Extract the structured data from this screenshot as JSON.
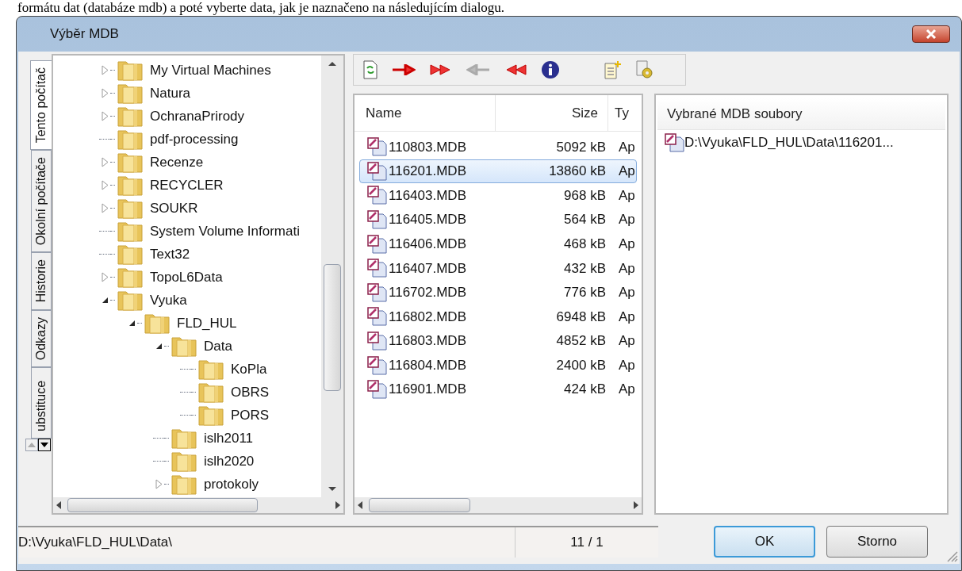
{
  "document_text": "formátu dat (databáze mdb) a poté vyberte data, jak je naznačeno na následujícím dialogu.",
  "window": {
    "title": "Výběr MDB"
  },
  "side_tabs": [
    {
      "label": "Tento počítač",
      "selected": true
    },
    {
      "label": "Okolní počítače",
      "selected": false
    },
    {
      "label": "Historie",
      "selected": false
    },
    {
      "label": "Odkazy",
      "selected": false
    },
    {
      "label": "ubstituce",
      "selected": false
    }
  ],
  "tree": [
    {
      "label": "My Virtual Machines",
      "expandable": true,
      "expanded": false
    },
    {
      "label": "Natura",
      "expandable": true,
      "expanded": false
    },
    {
      "label": "OchranaPrirody",
      "expandable": true,
      "expanded": false
    },
    {
      "label": "pdf-processing",
      "expandable": false
    },
    {
      "label": "Recenze",
      "expandable": true,
      "expanded": false
    },
    {
      "label": "RECYCLER",
      "expandable": true,
      "expanded": false
    },
    {
      "label": "SOUKR",
      "expandable": true,
      "expanded": false
    },
    {
      "label": "System Volume Informati",
      "expandable": false
    },
    {
      "label": "Text32",
      "expandable": false
    },
    {
      "label": "TopoL6Data",
      "expandable": true,
      "expanded": false
    },
    {
      "label": "Vyuka",
      "expandable": true,
      "expanded": true,
      "children": [
        {
          "label": "FLD_HUL",
          "expandable": true,
          "expanded": true,
          "children": [
            {
              "label": "Data",
              "expandable": true,
              "expanded": true,
              "children": [
                {
                  "label": "KoPla",
                  "expandable": false
                },
                {
                  "label": "OBRS",
                  "expandable": false
                },
                {
                  "label": "PORS",
                  "expandable": false
                }
              ]
            },
            {
              "label": "islh2011",
              "expandable": false
            },
            {
              "label": "islh2020",
              "expandable": false
            },
            {
              "label": "protokoly",
              "expandable": true,
              "expanded": false
            }
          ]
        }
      ]
    }
  ],
  "file_list": {
    "columns": [
      "Name",
      "Size",
      "Ty"
    ],
    "rows": [
      {
        "name": "110803.MDB",
        "size": "5092 kB",
        "type": "Ap",
        "selected": false
      },
      {
        "name": "116201.MDB",
        "size": "13860 kB",
        "type": "Ap",
        "selected": true
      },
      {
        "name": "116403.MDB",
        "size": "968 kB",
        "type": "Ap",
        "selected": false
      },
      {
        "name": "116405.MDB",
        "size": "564 kB",
        "type": "Ap",
        "selected": false
      },
      {
        "name": "116406.MDB",
        "size": "468 kB",
        "type": "Ap",
        "selected": false
      },
      {
        "name": "116407.MDB",
        "size": "432 kB",
        "type": "Ap",
        "selected": false
      },
      {
        "name": "116702.MDB",
        "size": "776 kB",
        "type": "Ap",
        "selected": false
      },
      {
        "name": "116802.MDB",
        "size": "6948 kB",
        "type": "Ap",
        "selected": false
      },
      {
        "name": "116803.MDB",
        "size": "4852 kB",
        "type": "Ap",
        "selected": false
      },
      {
        "name": "116804.MDB",
        "size": "2400 kB",
        "type": "Ap",
        "selected": false
      },
      {
        "name": "116901.MDB",
        "size": "424 kB",
        "type": "Ap",
        "selected": false
      }
    ]
  },
  "selected_list": {
    "header": "Vybrané MDB soubory",
    "items": [
      "D:\\Vyuka\\FLD_HUL\\Data\\116201..."
    ]
  },
  "status_bar": {
    "path": "D:\\Vyuka\\FLD_HUL\\Data\\",
    "count": "11 / 1"
  },
  "buttons": [
    {
      "label": "OK",
      "default": true
    },
    {
      "label": "Storno",
      "default": false
    }
  ]
}
